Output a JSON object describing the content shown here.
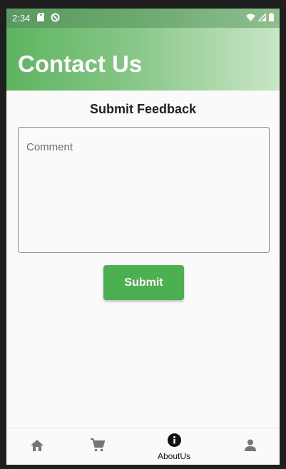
{
  "status_bar": {
    "time": "2:34",
    "icons_left": [
      "sd-card-icon",
      "sync-icon"
    ],
    "icons_right": [
      "wifi-icon",
      "signal-icon",
      "battery-icon"
    ]
  },
  "app_bar": {
    "title": "Contact Us"
  },
  "form": {
    "heading": "Submit Feedback",
    "comment_placeholder": "Comment",
    "comment_value": "",
    "submit_label": "Submit"
  },
  "bottom_nav": {
    "items": [
      {
        "icon": "home-icon",
        "label": "",
        "selected": false
      },
      {
        "icon": "cart-icon",
        "label": "",
        "selected": false
      },
      {
        "icon": "info-icon",
        "label": "AboutUs",
        "selected": true
      },
      {
        "icon": "person-icon",
        "label": "",
        "selected": false
      }
    ]
  },
  "colors": {
    "primary": "#4caf50",
    "appbar_gradient_start": "#5db460",
    "appbar_gradient_end": "#c9e6c6"
  }
}
